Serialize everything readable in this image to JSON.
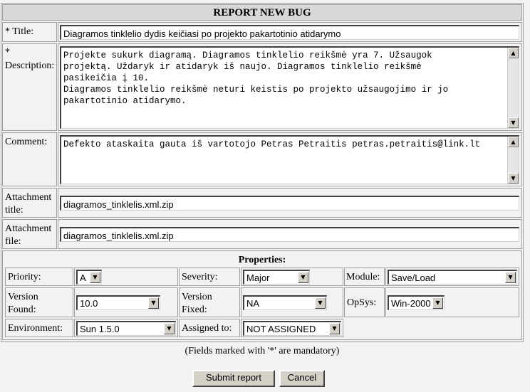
{
  "form": {
    "title": "REPORT NEW BUG",
    "title_label": "* Title:",
    "title_value": "Diagramos tinklelio dydis keičiasi po projekto pakartotinio atidarymo",
    "description_label_star": "*",
    "description_label": "Description:",
    "description_value": "Projekte sukurk diagramą. Diagramos tinklelio reikšmė yra 7. Užsaugok\nprojektą. Uždaryk ir atidaryk iš naujo. Diagramos tinklelio reikšmė\npasikeičia į 10.\nDiagramos tinklelio reikšmė neturi keistis po projekto užsaugojimo ir jo\npakartotinio atidarymo.",
    "comment_label": "Comment:",
    "comment_value": "Defekto ataskaita gauta iš vartotojo Petras Petraitis petras.petraitis@link.lt",
    "attachment_title_label_1": "Attachment",
    "attachment_title_label_2": "title:",
    "attachment_title_value": "diagramos_tinklelis.xml.zip",
    "attachment_file_label_1": "Attachment",
    "attachment_file_label_2": "file:",
    "attachment_file_value": "diagramos_tinklelis.xml.zip"
  },
  "properties": {
    "heading": "Properties:",
    "priority_label": "Priority:",
    "priority_value": "A",
    "severity_label": "Severity:",
    "severity_value": "Major",
    "module_label": "Module:",
    "module_value": "Save/Load",
    "version_found_label_1": "Version",
    "version_found_label_2": "Found:",
    "version_found_value": "10.0",
    "version_fixed_label_1": "Version",
    "version_fixed_label_2": "Fixed:",
    "version_fixed_value": "NA",
    "opsys_label": "OpSys:",
    "opsys_value": "Win-2000",
    "environment_label": "Environment:",
    "environment_value": "Sun 1.5.0",
    "assigned_label": "Assigned to:",
    "assigned_value": "NOT ASSIGNED"
  },
  "footer": {
    "mandatory_note": "(Fields marked with '*' are mandatory)",
    "submit_label": "Submit report",
    "cancel_label": "Cancel"
  },
  "icons": {
    "scroll_up": "▲",
    "scroll_down": "▼",
    "dropdown": "▼"
  }
}
